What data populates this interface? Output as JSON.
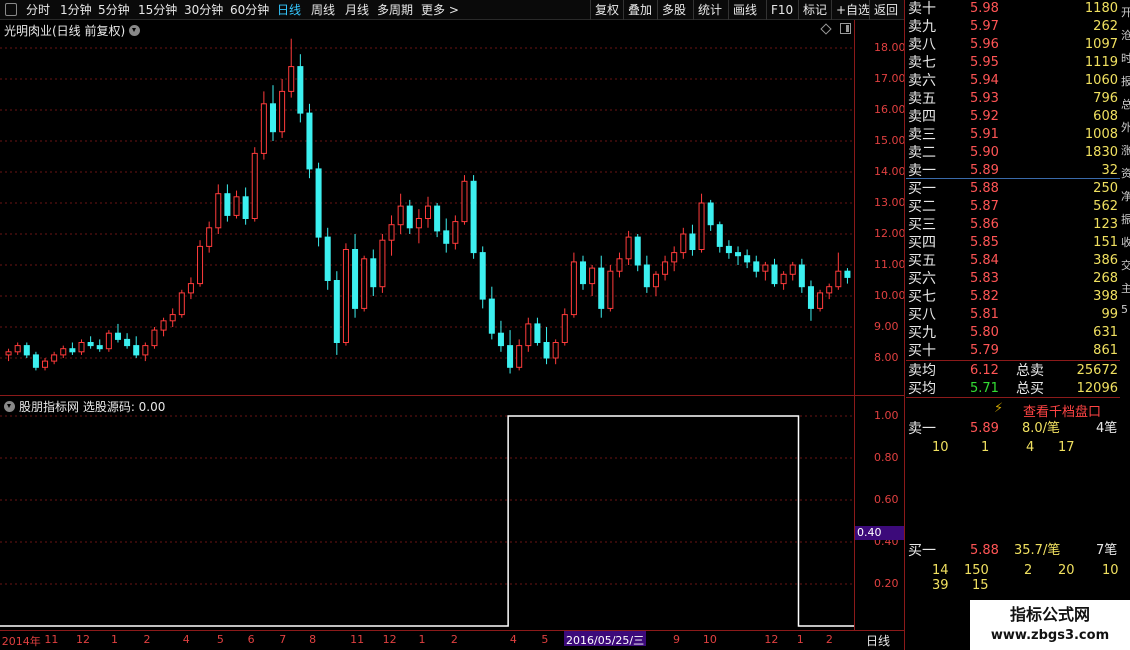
{
  "toolbar": {
    "items": [
      "分时",
      "1分钟",
      "5分钟",
      "15分钟",
      "30分钟",
      "60分钟",
      "日线",
      "周线",
      "月线",
      "多周期",
      "更多 >"
    ],
    "active": "日线",
    "actions": [
      "复权",
      "叠加",
      "多股",
      "统计",
      "画线",
      "F10",
      "标记",
      "+自选",
      "返回"
    ]
  },
  "chart_header": {
    "title": "光明肉业(日线 前复权)"
  },
  "main_chart": {
    "price_ticks": [
      "18.00",
      "17.00",
      "16.00",
      "15.00",
      "14.00",
      "13.00",
      "12.00",
      "11.00",
      "10.00",
      "9.00",
      "8.00"
    ],
    "up_color": "#ff3b3b",
    "down_color": "#3cf0f0",
    "candles": [
      [
        8.1,
        8.3,
        7.9,
        8.2
      ],
      [
        8.2,
        8.5,
        8.1,
        8.4
      ],
      [
        8.4,
        8.5,
        8.0,
        8.1
      ],
      [
        8.1,
        8.2,
        7.6,
        7.7
      ],
      [
        7.7,
        8.0,
        7.6,
        7.9
      ],
      [
        7.9,
        8.2,
        7.8,
        8.1
      ],
      [
        8.1,
        8.4,
        8.0,
        8.3
      ],
      [
        8.3,
        8.5,
        8.1,
        8.2
      ],
      [
        8.2,
        8.6,
        8.1,
        8.5
      ],
      [
        8.5,
        8.7,
        8.3,
        8.4
      ],
      [
        8.4,
        8.6,
        8.2,
        8.3
      ],
      [
        8.3,
        8.9,
        8.2,
        8.8
      ],
      [
        8.8,
        9.1,
        8.5,
        8.6
      ],
      [
        8.6,
        8.8,
        8.3,
        8.4
      ],
      [
        8.4,
        8.7,
        8.0,
        8.1
      ],
      [
        8.1,
        8.5,
        7.9,
        8.4
      ],
      [
        8.4,
        9.0,
        8.3,
        8.9
      ],
      [
        8.9,
        9.3,
        8.7,
        9.2
      ],
      [
        9.2,
        9.6,
        9.0,
        9.4
      ],
      [
        9.4,
        10.2,
        9.3,
        10.1
      ],
      [
        10.1,
        10.6,
        9.9,
        10.4
      ],
      [
        10.4,
        11.8,
        10.3,
        11.6
      ],
      [
        11.6,
        12.4,
        11.4,
        12.2
      ],
      [
        12.2,
        13.6,
        12.0,
        13.3
      ],
      [
        13.3,
        13.6,
        12.4,
        12.6
      ],
      [
        12.6,
        13.4,
        12.5,
        13.2
      ],
      [
        13.2,
        13.5,
        12.3,
        12.5
      ],
      [
        12.5,
        14.8,
        12.4,
        14.6
      ],
      [
        14.6,
        16.6,
        14.4,
        16.2
      ],
      [
        16.2,
        16.8,
        15.0,
        15.3
      ],
      [
        15.3,
        17.0,
        15.1,
        16.6
      ],
      [
        16.6,
        18.3,
        16.4,
        17.4
      ],
      [
        17.4,
        17.8,
        15.6,
        15.9
      ],
      [
        15.9,
        16.2,
        13.8,
        14.1
      ],
      [
        14.1,
        14.3,
        11.6,
        11.9
      ],
      [
        11.9,
        12.2,
        10.2,
        10.5
      ],
      [
        10.5,
        10.8,
        8.1,
        8.5
      ],
      [
        8.5,
        11.7,
        8.4,
        11.5
      ],
      [
        11.5,
        12.0,
        9.3,
        9.6
      ],
      [
        9.6,
        11.3,
        9.5,
        11.2
      ],
      [
        11.2,
        11.5,
        10.0,
        10.3
      ],
      [
        10.3,
        12.0,
        10.1,
        11.8
      ],
      [
        11.8,
        12.6,
        11.3,
        12.3
      ],
      [
        12.3,
        13.3,
        12.0,
        12.9
      ],
      [
        12.9,
        13.1,
        12.0,
        12.2
      ],
      [
        12.2,
        12.8,
        11.7,
        12.5
      ],
      [
        12.5,
        13.2,
        12.2,
        12.9
      ],
      [
        12.9,
        13.0,
        11.9,
        12.1
      ],
      [
        12.1,
        12.5,
        11.4,
        11.7
      ],
      [
        11.7,
        12.6,
        11.5,
        12.4
      ],
      [
        12.4,
        13.9,
        12.3,
        13.7
      ],
      [
        13.7,
        13.9,
        11.2,
        11.4
      ],
      [
        11.4,
        11.6,
        9.6,
        9.9
      ],
      [
        9.9,
        10.3,
        8.6,
        8.8
      ],
      [
        8.8,
        9.2,
        8.2,
        8.4
      ],
      [
        8.4,
        8.9,
        7.5,
        7.7
      ],
      [
        7.7,
        8.6,
        7.6,
        8.4
      ],
      [
        8.4,
        9.3,
        8.2,
        9.1
      ],
      [
        9.1,
        9.3,
        8.4,
        8.5
      ],
      [
        8.5,
        9.0,
        7.8,
        8.0
      ],
      [
        8.0,
        8.6,
        7.8,
        8.5
      ],
      [
        8.5,
        9.6,
        8.4,
        9.4
      ],
      [
        9.4,
        11.4,
        9.3,
        11.1
      ],
      [
        11.1,
        11.3,
        10.2,
        10.4
      ],
      [
        10.4,
        11.0,
        10.0,
        10.9
      ],
      [
        10.9,
        11.3,
        9.3,
        9.6
      ],
      [
        9.6,
        11.0,
        9.5,
        10.8
      ],
      [
        10.8,
        11.4,
        10.6,
        11.2
      ],
      [
        11.2,
        12.1,
        11.0,
        11.9
      ],
      [
        11.9,
        12.0,
        10.8,
        11.0
      ],
      [
        11.0,
        11.3,
        10.1,
        10.3
      ],
      [
        10.3,
        10.8,
        10.0,
        10.7
      ],
      [
        10.7,
        11.3,
        10.5,
        11.1
      ],
      [
        11.1,
        11.6,
        10.8,
        11.4
      ],
      [
        11.4,
        12.2,
        11.2,
        12.0
      ],
      [
        12.0,
        12.3,
        11.3,
        11.5
      ],
      [
        11.5,
        13.3,
        11.4,
        13.0
      ],
      [
        13.0,
        13.1,
        12.1,
        12.3
      ],
      [
        12.3,
        12.4,
        11.4,
        11.6
      ],
      [
        11.6,
        11.8,
        11.2,
        11.4
      ],
      [
        11.4,
        11.6,
        11.0,
        11.3
      ],
      [
        11.3,
        11.5,
        10.9,
        11.1
      ],
      [
        11.1,
        11.3,
        10.6,
        10.8
      ],
      [
        10.8,
        11.1,
        10.5,
        11.0
      ],
      [
        11.0,
        11.2,
        10.3,
        10.4
      ],
      [
        10.4,
        10.8,
        10.2,
        10.7
      ],
      [
        10.7,
        11.1,
        10.5,
        11.0
      ],
      [
        11.0,
        11.2,
        10.1,
        10.3
      ],
      [
        10.3,
        10.5,
        9.2,
        9.6
      ],
      [
        9.6,
        10.2,
        9.5,
        10.1
      ],
      [
        10.1,
        10.4,
        9.9,
        10.3
      ],
      [
        10.3,
        11.4,
        10.2,
        10.8
      ],
      [
        10.8,
        10.9,
        10.4,
        10.6
      ]
    ]
  },
  "indicator": {
    "title": "股朋指标网 选股源码: 0.00",
    "ticks": [
      "1.00",
      "0.80",
      "0.60",
      "0.40",
      "0.20"
    ],
    "cursor_value": "0.40",
    "step_start_frac": 0.595,
    "step_end_frac": 0.935
  },
  "xaxis": {
    "labels": [
      {
        "t": "2014年",
        "f": 0.002
      },
      {
        "t": "11",
        "f": 0.052
      },
      {
        "t": "12",
        "f": 0.089
      },
      {
        "t": "1",
        "f": 0.13
      },
      {
        "t": "2",
        "f": 0.168
      },
      {
        "t": "4",
        "f": 0.214
      },
      {
        "t": "5",
        "f": 0.254
      },
      {
        "t": "6",
        "f": 0.29
      },
      {
        "t": "7",
        "f": 0.327
      },
      {
        "t": "8",
        "f": 0.362
      },
      {
        "t": "11",
        "f": 0.41
      },
      {
        "t": "12",
        "f": 0.448
      },
      {
        "t": "1",
        "f": 0.49
      },
      {
        "t": "2",
        "f": 0.528
      },
      {
        "t": "4",
        "f": 0.597
      },
      {
        "t": "5",
        "f": 0.634
      },
      {
        "t": "9",
        "f": 0.788
      },
      {
        "t": "10",
        "f": 0.823
      },
      {
        "t": "12",
        "f": 0.895
      },
      {
        "t": "1",
        "f": 0.933
      },
      {
        "t": "2",
        "f": 0.967
      }
    ],
    "highlight": "2016/05/25/三",
    "period": "日线"
  },
  "orderbook": {
    "asks": [
      {
        "label": "卖十",
        "price": "5.98",
        "vol": "1180"
      },
      {
        "label": "卖九",
        "price": "5.97",
        "vol": "262"
      },
      {
        "label": "卖八",
        "price": "5.96",
        "vol": "1097"
      },
      {
        "label": "卖七",
        "price": "5.95",
        "vol": "1119"
      },
      {
        "label": "卖六",
        "price": "5.94",
        "vol": "1060"
      },
      {
        "label": "卖五",
        "price": "5.93",
        "vol": "796"
      },
      {
        "label": "卖四",
        "price": "5.92",
        "vol": "608"
      },
      {
        "label": "卖三",
        "price": "5.91",
        "vol": "1008"
      },
      {
        "label": "卖二",
        "price": "5.90",
        "vol": "1830"
      },
      {
        "label": "卖一",
        "price": "5.89",
        "vol": "32"
      }
    ],
    "bids": [
      {
        "label": "买一",
        "price": "5.88",
        "vol": "250"
      },
      {
        "label": "买二",
        "price": "5.87",
        "vol": "562"
      },
      {
        "label": "买三",
        "price": "5.86",
        "vol": "123"
      },
      {
        "label": "买四",
        "price": "5.85",
        "vol": "151"
      },
      {
        "label": "买五",
        "price": "5.84",
        "vol": "386"
      },
      {
        "label": "买六",
        "price": "5.83",
        "vol": "268"
      },
      {
        "label": "买七",
        "price": "5.82",
        "vol": "398"
      },
      {
        "label": "买八",
        "price": "5.81",
        "vol": "99"
      },
      {
        "label": "买九",
        "price": "5.80",
        "vol": "631"
      },
      {
        "label": "买十",
        "price": "5.79",
        "vol": "861"
      }
    ],
    "ask_avg": {
      "label": "卖均",
      "price": "6.12",
      "total_label": "总卖",
      "total": "25672"
    },
    "bid_avg": {
      "label": "买均",
      "price": "5.71",
      "total_label": "总买",
      "total": "12096"
    },
    "thousand_btn": "查看千档盘口",
    "sell1_detail": {
      "label": "卖一",
      "price": "5.89",
      "avg": "8.0/笔",
      "count": "4笔",
      "orders": [
        "10",
        "1",
        "4",
        "17"
      ]
    },
    "buy1_detail": {
      "label": "买一",
      "price": "5.88",
      "avg": "35.7/笔",
      "count": "7笔",
      "orders": [
        "14",
        "150",
        "2",
        "20",
        "10",
        "39",
        "15"
      ]
    }
  },
  "right_cut": [
    "开",
    "沧",
    "时",
    "报",
    "总",
    "外",
    "涨",
    "资",
    "净",
    "振",
    "收",
    "交",
    "主",
    "5"
  ],
  "watermark": {
    "line1": "指标公式网",
    "line2": "www.zbgs3.com"
  }
}
